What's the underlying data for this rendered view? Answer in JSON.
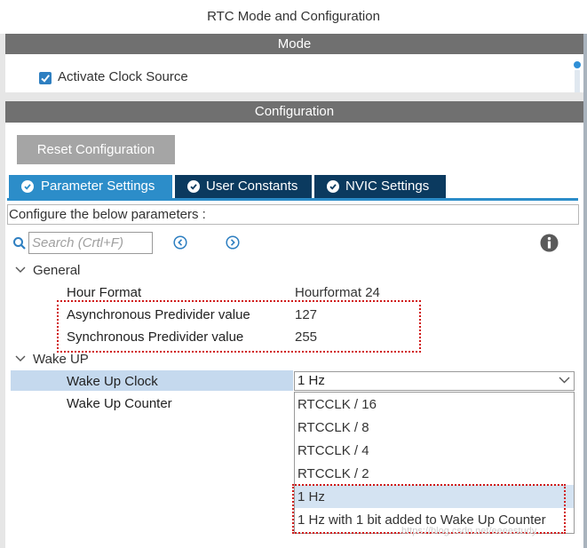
{
  "window": {
    "title": "RTC Mode and Configuration"
  },
  "mode": {
    "header": "Mode",
    "activate_clock_source": {
      "label": "Activate Clock Source",
      "checked": true
    }
  },
  "configuration": {
    "header": "Configuration",
    "reset_button": "Reset Configuration",
    "tabs": [
      {
        "label": "Parameter Settings",
        "active": true
      },
      {
        "label": "User Constants",
        "active": false
      },
      {
        "label": "NVIC Settings",
        "active": false
      }
    ],
    "instruction": "Configure the below parameters :",
    "search": {
      "placeholder": "Search (Crtl+F)",
      "value": ""
    },
    "groups": {
      "general": {
        "label": "General",
        "params": [
          {
            "name": "Hour Format",
            "value": "Hourformat 24"
          },
          {
            "name": "Asynchronous Predivider value",
            "value": "127"
          },
          {
            "name": "Synchronous Predivider value",
            "value": "255"
          }
        ]
      },
      "wake_up": {
        "label": "Wake UP",
        "params": [
          {
            "name": "Wake Up Clock",
            "value": "1 Hz"
          },
          {
            "name": "Wake Up Counter",
            "value": ""
          }
        ]
      }
    },
    "wake_up_clock_options": [
      "RTCCLK / 16",
      "RTCCLK / 8",
      "RTCCLK / 4",
      "RTCCLK / 2",
      "1 Hz",
      "1 Hz with 1 bit added to Wake Up Counter"
    ],
    "wake_up_clock_selected_index": 4
  },
  "watermark": "https://blog.csdn.net/eeeestudy",
  "colors": {
    "panel_header": "#707070",
    "tab_active": "#2c8dc9",
    "tab_inactive": "#0b3a5f",
    "accent_blue": "#2e7fc1",
    "row_highlight": "#c5d9ee",
    "annotation_red": "#d01818"
  },
  "icons": [
    "check-icon",
    "search-icon",
    "prev-arrow-icon",
    "next-arrow-icon",
    "info-icon",
    "chevron-down-icon"
  ]
}
